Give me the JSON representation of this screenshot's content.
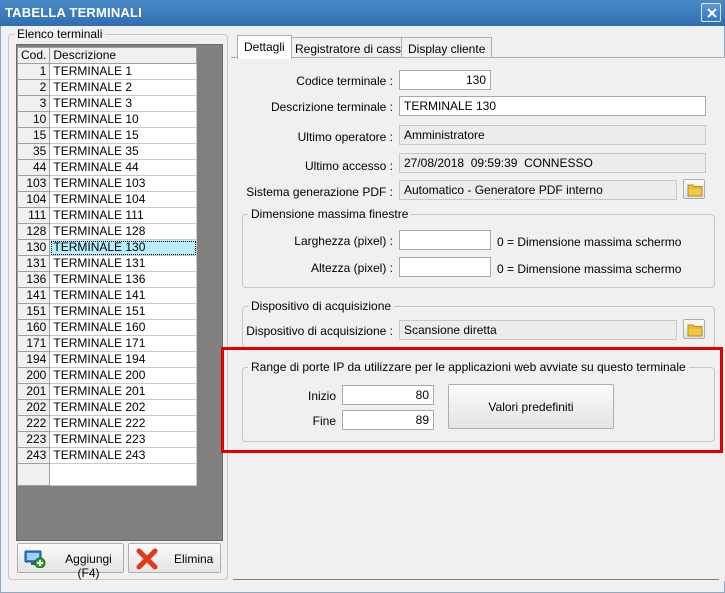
{
  "window": {
    "title": "TABELLA TERMINALI"
  },
  "terminal_list": {
    "group_title": "Elenco terminali",
    "columns": [
      "Cod.",
      "Descrizione"
    ],
    "rows": [
      {
        "cod": "1",
        "desc": "TERMINALE 1"
      },
      {
        "cod": "2",
        "desc": "TERMINALE 2"
      },
      {
        "cod": "3",
        "desc": "TERMINALE 3"
      },
      {
        "cod": "10",
        "desc": "TERMINALE 10"
      },
      {
        "cod": "15",
        "desc": "TERMINALE 15"
      },
      {
        "cod": "35",
        "desc": "TERMINALE 35"
      },
      {
        "cod": "44",
        "desc": "TERMINALE 44"
      },
      {
        "cod": "103",
        "desc": "TERMINALE 103"
      },
      {
        "cod": "104",
        "desc": "TERMINALE 104"
      },
      {
        "cod": "111",
        "desc": "TERMINALE 111"
      },
      {
        "cod": "128",
        "desc": "TERMINALE 128"
      },
      {
        "cod": "130",
        "desc": "TERMINALE 130"
      },
      {
        "cod": "131",
        "desc": "TERMINALE 131"
      },
      {
        "cod": "136",
        "desc": "TERMINALE 136"
      },
      {
        "cod": "141",
        "desc": "TERMINALE 141"
      },
      {
        "cod": "151",
        "desc": "TERMINALE 151"
      },
      {
        "cod": "160",
        "desc": "TERMINALE 160"
      },
      {
        "cod": "171",
        "desc": "TERMINALE 171"
      },
      {
        "cod": "194",
        "desc": "TERMINALE 194"
      },
      {
        "cod": "200",
        "desc": "TERMINALE 200"
      },
      {
        "cod": "201",
        "desc": "TERMINALE 201"
      },
      {
        "cod": "202",
        "desc": "TERMINALE 202"
      },
      {
        "cod": "222",
        "desc": "TERMINALE 222"
      },
      {
        "cod": "223",
        "desc": "TERMINALE 223"
      },
      {
        "cod": "243",
        "desc": "TERMINALE 243"
      }
    ],
    "selected_cod": "130",
    "add_button": "Aggiungi (F4)",
    "delete_button": "Elimina"
  },
  "tabs": [
    {
      "label": "Dettagli",
      "active": true
    },
    {
      "label": "Registratore di cassa",
      "active": false
    },
    {
      "label": "Display cliente",
      "active": false
    }
  ],
  "details": {
    "codice_label": "Codice terminale :",
    "codice_value": "130",
    "descrizione_label": "Descrizione terminale :",
    "descrizione_value": "TERMINALE 130",
    "operatore_label": "Ultimo operatore :",
    "operatore_value": "Amministratore",
    "accesso_label": "Ultimo accesso :",
    "accesso_value": "27/08/2018  09:59:39  CONNESSO",
    "pdf_label": "Sistema generazione PDF :",
    "pdf_value": "Automatico - Generatore PDF interno"
  },
  "window_size": {
    "group_title": "Dimensione massima finestre",
    "width_label": "Larghezza (pixel) :",
    "width_value": "",
    "width_hint": "0 = Dimensione massima schermo",
    "height_label": "Altezza (pixel) :",
    "height_value": "",
    "height_hint": "0 = Dimensione massima schermo"
  },
  "acquisition": {
    "group_title": "Dispositivo di acquisizione",
    "label": "Dispositivo di acquisizione :",
    "value": "Scansione diretta"
  },
  "port_range": {
    "group_title": "Range di porte IP da utilizzare per le applicazioni web avviate su questo terminale",
    "start_label": "Inizio",
    "start_value": "80",
    "end_label": "Fine",
    "end_value": "89",
    "defaults_button": "Valori predefiniti"
  },
  "colors": {
    "title_bar": "#2f6fb0",
    "selection": "#b9eefc",
    "highlight_box": "#e00000"
  }
}
